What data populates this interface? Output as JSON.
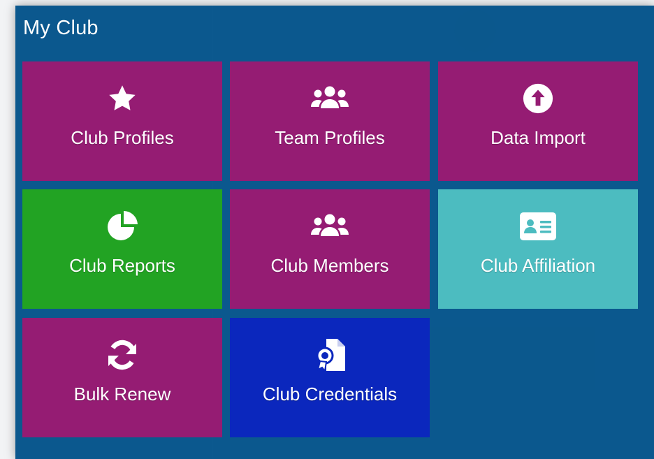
{
  "panel": {
    "title": "My Club"
  },
  "tiles": [
    {
      "label": "Club Profiles",
      "icon": "star-icon",
      "color": "#951c73"
    },
    {
      "label": "Team Profiles",
      "icon": "users-icon",
      "color": "#951c73"
    },
    {
      "label": "Data Import",
      "icon": "upload-circle-icon",
      "color": "#951c73"
    },
    {
      "label": "Club Reports",
      "icon": "pie-chart-icon",
      "color": "#22a323"
    },
    {
      "label": "Club Members",
      "icon": "users-icon",
      "color": "#951c73"
    },
    {
      "label": "Club Affiliation",
      "icon": "id-card-icon",
      "color": "#4cbcc0"
    },
    {
      "label": "Bulk Renew",
      "icon": "refresh-icon",
      "color": "#951c73"
    },
    {
      "label": "Club Credentials",
      "icon": "certificate-document-icon",
      "color": "#0b27bd"
    }
  ]
}
